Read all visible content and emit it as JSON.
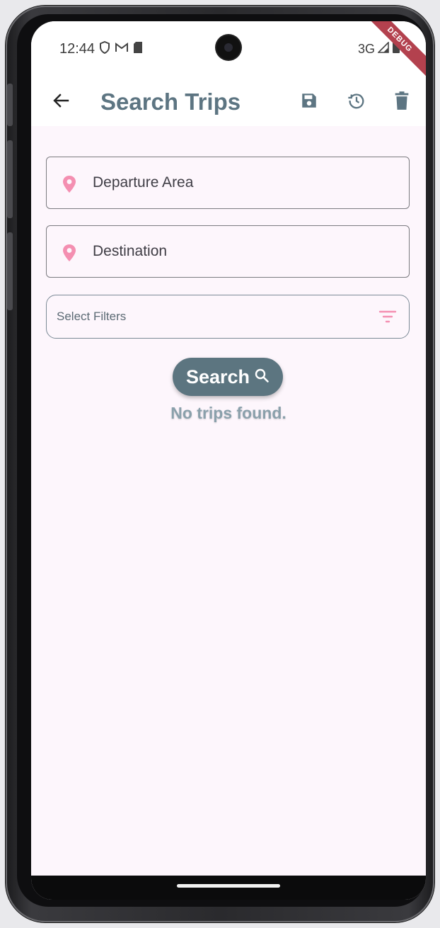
{
  "status_bar": {
    "time": "12:44",
    "network": "3G",
    "debug_label": "DEBUG",
    "icons": [
      "shield-icon",
      "gmail-icon",
      "sd-card-icon",
      "signal-icon",
      "battery-icon"
    ]
  },
  "app_bar": {
    "title": "Search Trips",
    "back_icon": "arrow-back-icon",
    "actions": [
      "save-icon",
      "history-icon",
      "delete-icon"
    ]
  },
  "form": {
    "departure_placeholder": "Departure Area",
    "destination_placeholder": "Destination",
    "filters_label": "Select Filters",
    "search_label": "Search",
    "empty_message": "No trips found."
  },
  "colors": {
    "primary": "#5c7580",
    "title": "#5d7582",
    "pin": "#f48fb1",
    "background": "#fdf6fc",
    "debug": "#b3414e"
  }
}
